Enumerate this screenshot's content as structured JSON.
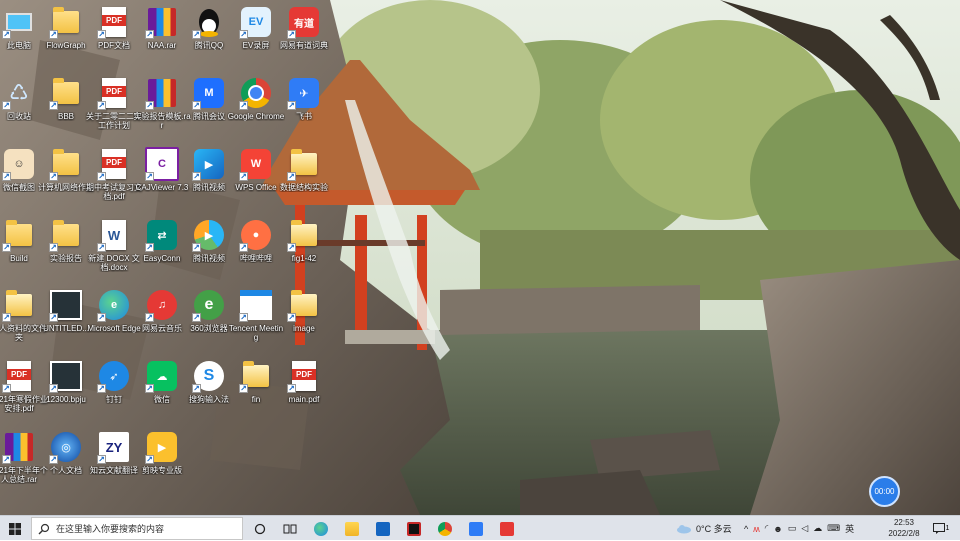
{
  "desktop_icons": [
    {
      "id": "i0",
      "label": "此电脑",
      "type": "pc"
    },
    {
      "id": "i1",
      "label": "FlowGraph",
      "type": "folder"
    },
    {
      "id": "i2",
      "label": "PDF文档",
      "type": "pdf"
    },
    {
      "id": "i3",
      "label": "NAA.rar",
      "type": "rar"
    },
    {
      "id": "i4",
      "label": "腾讯QQ",
      "type": "qq"
    },
    {
      "id": "i5",
      "label": "EV录屏",
      "type": "ev"
    },
    {
      "id": "i6",
      "label": "网易有道词典",
      "type": "youdao"
    },
    {
      "id": "i7",
      "label": "回收站",
      "type": "recycle"
    },
    {
      "id": "i8",
      "label": "BBB",
      "type": "folder"
    },
    {
      "id": "i9",
      "label": "关于二零二二年工作计划",
      "type": "pdf"
    },
    {
      "id": "i10",
      "label": "实验报告模板.rar",
      "type": "rar"
    },
    {
      "id": "i11",
      "label": "腾讯会议",
      "type": "meeting"
    },
    {
      "id": "i12",
      "label": "Google Chrome",
      "type": "chrome"
    },
    {
      "id": "i13",
      "label": "飞书",
      "type": "feishu"
    },
    {
      "id": "i14",
      "label": "微信截图",
      "type": "avatar"
    },
    {
      "id": "i15",
      "label": "计算机网络作业",
      "type": "folder"
    },
    {
      "id": "i16",
      "label": "期中考试复习文档.pdf",
      "type": "pdf"
    },
    {
      "id": "i17",
      "label": "CAJViewer 7.3",
      "type": "caj"
    },
    {
      "id": "i18",
      "label": "腾讯视频",
      "type": "tvideo"
    },
    {
      "id": "i19",
      "label": "WPS Office",
      "type": "wps"
    },
    {
      "id": "i20",
      "label": "数据结构实验",
      "type": "folder2"
    },
    {
      "id": "i21",
      "label": "Build",
      "type": "folder"
    },
    {
      "id": "i22",
      "label": "实验报告",
      "type": "folder"
    },
    {
      "id": "i23",
      "label": "新建 DOCX 文档.docx",
      "type": "doc"
    },
    {
      "id": "i24",
      "label": "EasyConn",
      "type": "easyconn"
    },
    {
      "id": "i25",
      "label": "腾讯视频",
      "type": "tvideo2"
    },
    {
      "id": "i26",
      "label": "哔哩哔哩",
      "type": "bird"
    },
    {
      "id": "i27",
      "label": "fig1-42",
      "type": "folder2"
    },
    {
      "id": "i28",
      "label": "个人资料的文件夹",
      "type": "folder2"
    },
    {
      "id": "i29",
      "label": "UNTITLED...",
      "type": "imgfile"
    },
    {
      "id": "i30",
      "label": "Microsoft Edge",
      "type": "edge"
    },
    {
      "id": "i31",
      "label": "网易云音乐",
      "type": "netease"
    },
    {
      "id": "i32",
      "label": "360浏览器",
      "type": "ie360"
    },
    {
      "id": "i33",
      "label": "Tencent Meeting",
      "type": "screenshot"
    },
    {
      "id": "i34",
      "label": "image",
      "type": "folder2"
    },
    {
      "id": "i35",
      "label": "2021年寒假作业安排.pdf",
      "type": "pdf"
    },
    {
      "id": "i36",
      "label": "12300.bpju",
      "type": "imgfile"
    },
    {
      "id": "i37",
      "label": "钉钉",
      "type": "dingtalk"
    },
    {
      "id": "i38",
      "label": "微信",
      "type": "wechat"
    },
    {
      "id": "i39",
      "label": "搜狗输入法",
      "type": "sogou"
    },
    {
      "id": "i40",
      "label": "fin",
      "type": "folder2"
    },
    {
      "id": "i41",
      "label": "main.pdf",
      "type": "pdf"
    },
    {
      "id": "i42",
      "label": "2021年下半年个人总结.rar",
      "type": "rar"
    },
    {
      "id": "i43",
      "label": "个人文档",
      "type": "netglobe"
    },
    {
      "id": "i44",
      "label": "知云文献翻译",
      "type": "zy"
    },
    {
      "id": "i45",
      "label": "剪映专业版",
      "type": "video"
    }
  ],
  "taskbar": {
    "search_placeholder": "在这里输入你要搜索的内容",
    "weather": "0°C 多云",
    "lang": "英",
    "time": "22:53",
    "date": "2022/2/8",
    "notif_count": "1"
  },
  "floating_timer": "00:00",
  "colors": {
    "taskbar": "#dfe3ea",
    "accent": "#2b7de9"
  }
}
